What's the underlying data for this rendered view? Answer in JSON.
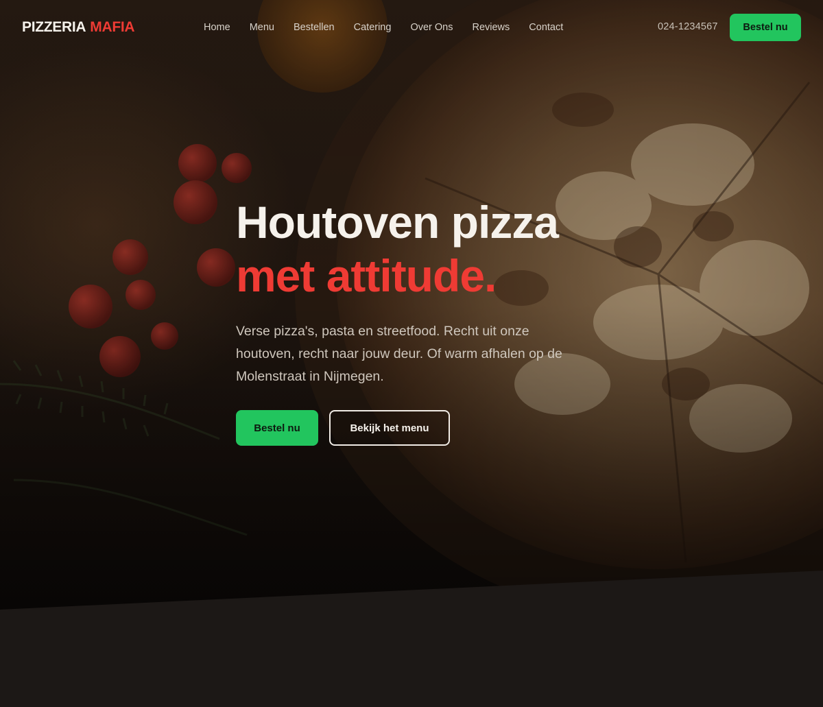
{
  "header": {
    "logo_part1": "PIZZERIA",
    "logo_part2": "MAFIA",
    "nav": [
      "Home",
      "Menu",
      "Bestellen",
      "Catering",
      "Over Ons",
      "Reviews",
      "Contact"
    ],
    "phone": "024-1234567",
    "cta_label": "Bestel nu"
  },
  "hero": {
    "title_line1": "Houtoven pizza",
    "title_line2": "met attitude.",
    "lead": "Verse pizza's, pasta en streetfood. Recht uit onze houtoven, recht naar jouw deur. Of warm afhalen op de Molenstraat in Nijmegen.",
    "primary_label": "Bestel nu",
    "secondary_label": "Bekijk het menu"
  },
  "colors": {
    "accent_red": "#ef3b34",
    "cta_green": "#22c55e",
    "background": "#1c1816"
  }
}
